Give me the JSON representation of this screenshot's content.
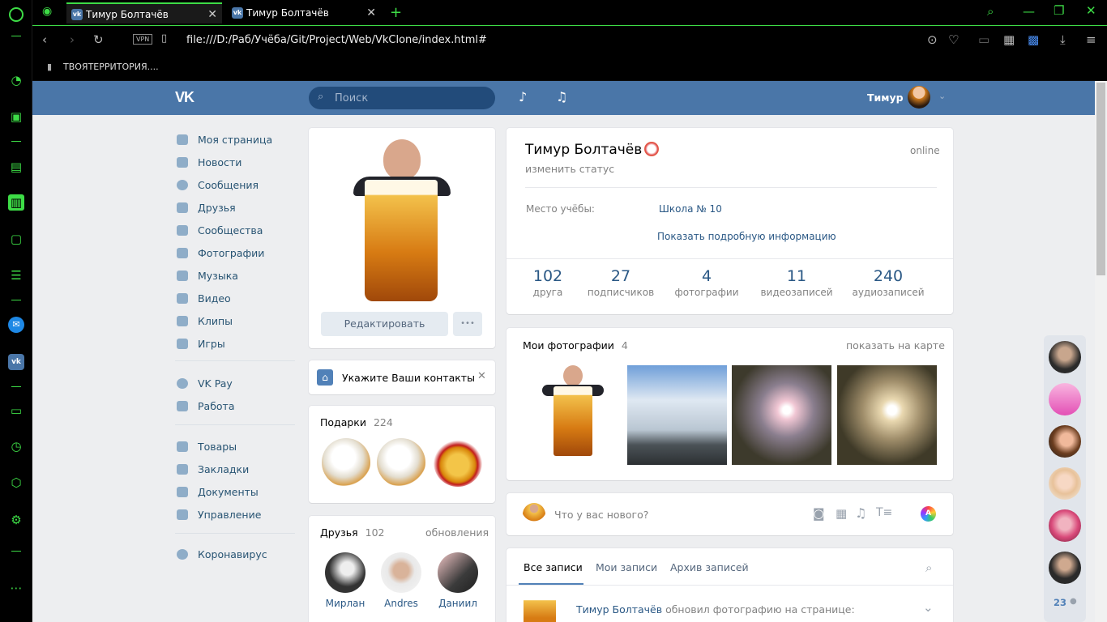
{
  "browser": {
    "tabs": [
      {
        "title": "Тимур Болтачёв",
        "favicon": "vk-icon"
      },
      {
        "title": "Тимур Болтачёв",
        "favicon": "vk-icon"
      }
    ],
    "url": "file:///D:/Раб/Учёба/Git/Project/Web/VkClone/index.html#",
    "vpn_label": "VPN",
    "bookmark": "ТВОЯТЕРРИТОРИЯ...."
  },
  "header": {
    "search_placeholder": "Поиск",
    "user_name": "Тимур"
  },
  "menu": [
    {
      "label": "Моя страница",
      "icon": "home-icon"
    },
    {
      "label": "Новости",
      "icon": "news-icon"
    },
    {
      "label": "Сообщения",
      "icon": "messages-icon"
    },
    {
      "label": "Друзья",
      "icon": "friends-icon"
    },
    {
      "label": "Сообщества",
      "icon": "groups-icon"
    },
    {
      "label": "Фотографии",
      "icon": "camera-icon"
    },
    {
      "label": "Музыка",
      "icon": "music-icon"
    },
    {
      "label": "Видео",
      "icon": "video-icon"
    },
    {
      "label": "Клипы",
      "icon": "clips-icon"
    },
    {
      "label": "Игры",
      "icon": "gamepad-icon"
    },
    {
      "label": "VK Pay",
      "icon": "vkpay-icon"
    },
    {
      "label": "Работа",
      "icon": "briefcase-icon"
    },
    {
      "label": "Товары",
      "icon": "bag-icon"
    },
    {
      "label": "Закладки",
      "icon": "star-icon"
    },
    {
      "label": "Документы",
      "icon": "document-icon"
    },
    {
      "label": "Управление",
      "icon": "gamepad-icon"
    },
    {
      "label": "Коронавирус",
      "icon": "virus-icon"
    }
  ],
  "profile": {
    "edit_label": "Редактировать",
    "more_label": "•••",
    "contacts_prompt": "Укажите Ваши контакты",
    "gifts_label": "Подарки",
    "gifts_count": "224",
    "friends_label": "Друзья",
    "friends_count": "102",
    "friends_updates": "обновления",
    "friends": [
      "Мирлан",
      "Andres",
      "Даниил"
    ]
  },
  "info": {
    "name": "Тимур Болтачёв",
    "status_link": "изменить статус",
    "online": "online",
    "edu_label": "Место учёбы:",
    "edu_value": "Школа № 10",
    "more_info": "Показать подробную информацию",
    "stats": [
      {
        "n": "102",
        "l": "друга"
      },
      {
        "n": "27",
        "l": "подписчиков"
      },
      {
        "n": "4",
        "l": "фотографии"
      },
      {
        "n": "11",
        "l": "видеозаписей"
      },
      {
        "n": "240",
        "l": "аудиозаписей"
      }
    ]
  },
  "photos": {
    "title": "Мои фотографии",
    "count": "4",
    "map_link": "показать на карте"
  },
  "composer": {
    "placeholder": "Что у вас нового?"
  },
  "wall": {
    "tabs": [
      "Все записи",
      "Мои записи",
      "Архив записей"
    ],
    "post_author": "Тимур Болтачёв",
    "post_text": "обновил фотографию на странице:"
  },
  "chat_panel": {
    "count": "23"
  }
}
